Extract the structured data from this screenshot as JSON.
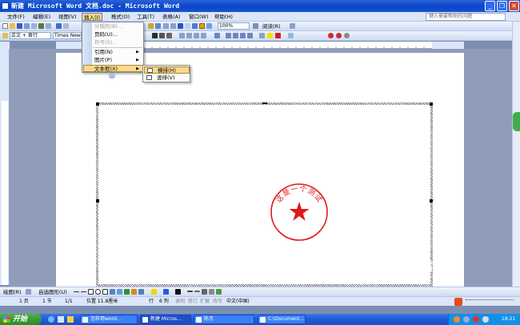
{
  "window": {
    "title": "新建 Microsoft Word 文档.doc - Microsoft Word",
    "min_glyph": "_",
    "max_glyph": "❐",
    "close_glyph": "✕"
  },
  "menubar": {
    "items": [
      "文件(F)",
      "编辑(E)",
      "视图(V)",
      "插入(I)",
      "格式(O)",
      "工具(T)",
      "表格(A)",
      "窗口(W)",
      "帮助(H)"
    ],
    "help_placeholder": "键入需要帮助的问题"
  },
  "toolbar": {
    "style": "正文 + 首行",
    "font": "Times New",
    "zoom": "100%",
    "read": "阅读(R)"
  },
  "insert_menu": {
    "items": [
      {
        "label": "分隔符(B)...",
        "enabled": false
      },
      {
        "label": "页码(U)...",
        "enabled": true
      },
      {
        "label": "符号(S)...",
        "enabled": false
      },
      {
        "label": "引用(N)",
        "enabled": true,
        "submenu": true
      },
      {
        "label": "图片(P)",
        "enabled": true,
        "submenu": true
      },
      {
        "label": "文本框(X)",
        "enabled": true,
        "submenu": true,
        "highlighted": true
      }
    ],
    "expand_glyph": "⌄"
  },
  "textbox_submenu": {
    "items": [
      {
        "label": "横排(H)",
        "highlighted": true
      },
      {
        "label": "竖排(V)",
        "highlighted": false
      }
    ]
  },
  "document": {
    "seal_text": "这是一个测试",
    "seal_color": "#e0191b"
  },
  "drawing_toolbar": {
    "draw": "绘图(R)",
    "autoshapes": "自选图形(U)"
  },
  "statusbar": {
    "page": "1 页",
    "section": "1 节",
    "page_of": "1/1",
    "position": "位置 11.8厘米",
    "line": "行",
    "col": "6 列",
    "rec": "录制",
    "trk": "修订",
    "ext": "扩展",
    "ovr": "改写",
    "lang": "中文(中国)"
  },
  "taskbar": {
    "start": "开始",
    "tasks": [
      "怎样用word...",
      "新建 Micros...",
      "陈杰",
      "C:\\Document..."
    ],
    "clock": "18:21"
  },
  "watermark": {
    "brand": "搜狗指南",
    "url": "zhinan.sogou.com"
  }
}
